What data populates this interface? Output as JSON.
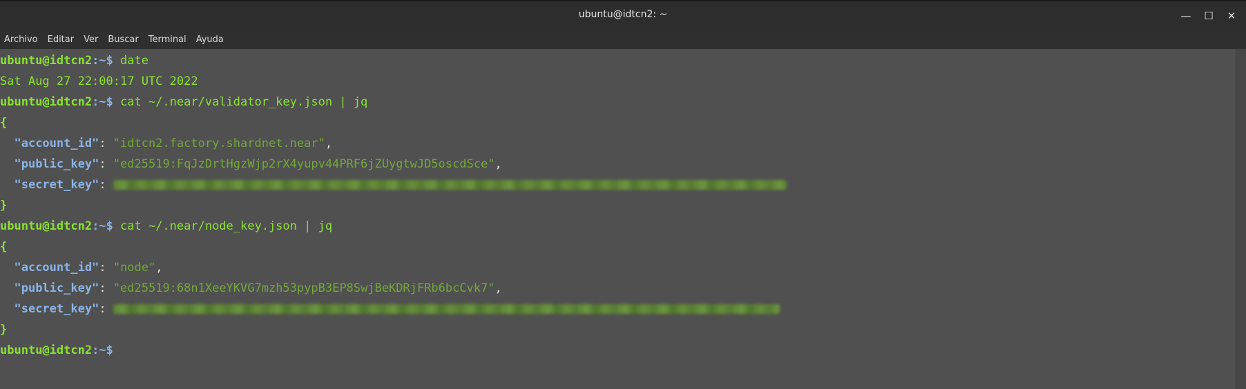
{
  "window": {
    "title": "ubuntu@idtcn2: ~",
    "controls": {
      "minimize": "—",
      "maximize": "☐",
      "close": "✕"
    }
  },
  "menu": [
    "Archivo",
    "Editar",
    "Ver",
    "Buscar",
    "Terminal",
    "Ayuda"
  ],
  "prompt": {
    "user": "ubuntu@idtcn2",
    "path": ":~$"
  },
  "lines": {
    "cmd1": " date",
    "out1": "Sat Aug 27 22:00:17 UTC 2022",
    "cmd2": " cat ~/.near/validator_key.json | jq",
    "cmd3": " cat ~/.near/node_key.json | jq"
  },
  "validator_key": {
    "account_id_key": "\"account_id\"",
    "account_id_val": "\"idtcn2.factory.shardnet.near\"",
    "public_key_key": "\"public_key\"",
    "public_key_val": "\"ed25519:FqJzDrtHgzWjp2rX4yupv44PRF6jZUygtwJD5oscdSce\"",
    "secret_key_key": "\"secret_key\""
  },
  "node_key": {
    "account_id_key": "\"account_id\"",
    "account_id_val": "\"node\"",
    "public_key_key": "\"public_key\"",
    "public_key_val": "\"ed25519:68n1XeeYKVG7mzh53pypB3EP8SwjBeKDRjFRb6bcCvk7\"",
    "secret_key_key": "\"secret_key\""
  },
  "symbols": {
    "open_brace": "{",
    "close_brace": "}",
    "colon": ": ",
    "comma": ",",
    "indent": "  "
  },
  "colors": {
    "background": "#505050",
    "prompt_green": "#8ae234",
    "key_blue": "#8ab4e8",
    "string_green": "#73a83a",
    "titlebar": "#2d2d2d"
  }
}
